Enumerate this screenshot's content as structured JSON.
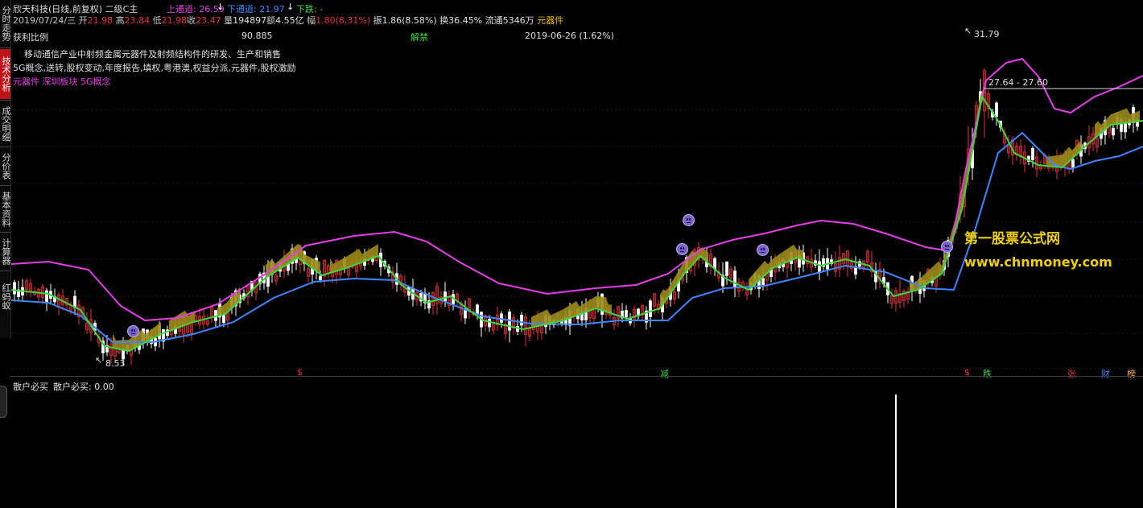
{
  "sidebar": {
    "tabs": [
      {
        "label": "分时走势",
        "active": false
      },
      {
        "label": "技术分析",
        "active": true
      },
      {
        "label": "成交明细",
        "active": false
      },
      {
        "label": "分价表",
        "active": false
      },
      {
        "label": "基本资料",
        "active": false
      },
      {
        "label": "计算器",
        "active": false
      },
      {
        "label": "红蚂蚁",
        "active": false
      }
    ]
  },
  "header": {
    "title": "欣天科技(日线,前复权) 二级C主",
    "up_channel_label": "上通道: 26.59",
    "up_arrow": "↓",
    "down_channel_label": "下通道: 21.97",
    "down_arrow": "↓",
    "fall_label": "下跌: -"
  },
  "quote": {
    "date": "2019/07/24/三",
    "open_label": "开",
    "open": "21.98",
    "high_label": "高",
    "high": "23.84",
    "low_label": "低",
    "low": "21.98",
    "close_label": "收",
    "close": "23.47",
    "volume_label": "量",
    "volume": "194897",
    "amount_label": "额",
    "amount": "4.55亿",
    "change_label": "幅",
    "change": "1.80(8.31%)",
    "amplitude": "振1.86(8.58%)",
    "turnover": "换36.45%",
    "float_shares": "流通5346万",
    "sector": "元器件"
  },
  "info": {
    "profit_label": "获利比例",
    "profit_value": "90.885",
    "unlock_label": "解禁",
    "unlock_date": "2019-06-26 (1.62%)",
    "business": "移动通信产业中射频金属元器件及射频结构件的研发、生产和销售",
    "concepts": "5G概念,送转,股权变动,年度报告,填权,粤港澳,权益分派,元器件,股权激励",
    "tags": "元器件 深圳板块 5G概念"
  },
  "annotations": {
    "high_price": "31.79",
    "low_price": "8.53",
    "range_label": "27.64 - 27.60"
  },
  "signals": [
    {
      "text": "$",
      "color": "#e83232"
    },
    {
      "text": "减",
      "color": "#3dd63d"
    },
    {
      "text": "$",
      "color": "#e83232"
    },
    {
      "text": "跌",
      "color": "#3dd63d"
    },
    {
      "text": "张",
      "color": "#e83232"
    },
    {
      "text": "财",
      "color": "#3d86ff"
    },
    {
      "text": "榜",
      "color": "#ffaa33"
    }
  ],
  "watermark": {
    "line1": "第一股票公式网",
    "line2": "www.chnmoney.com"
  },
  "indicator": {
    "title": "散户必买",
    "value_label": "散户必买: 0.00"
  },
  "colors": {
    "upper_band": "#e63ee6",
    "lower_band": "#3d86ff",
    "mid_line": "#3dd63d",
    "ribbon": "#9a8a1a",
    "candle_up": "#e83232",
    "candle_down": "#ffffff"
  }
}
